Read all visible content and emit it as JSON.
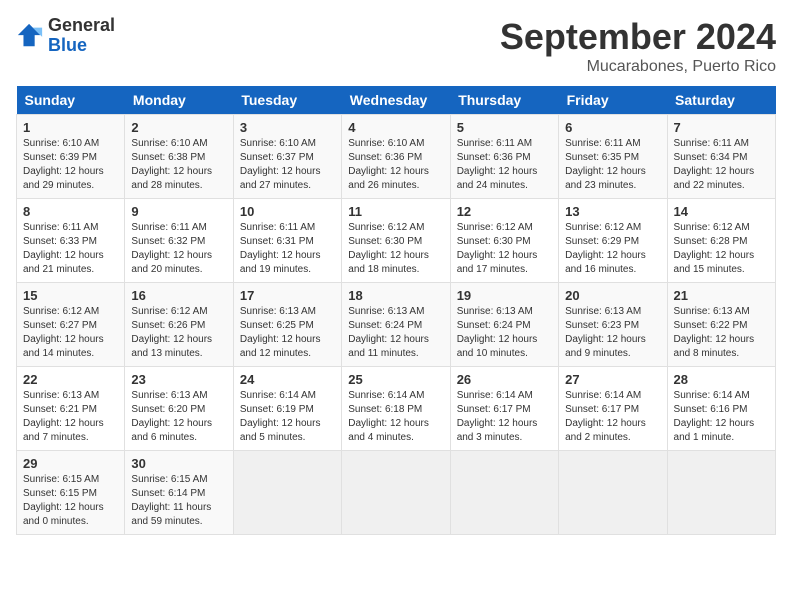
{
  "header": {
    "logo_general": "General",
    "logo_blue": "Blue",
    "month_title": "September 2024",
    "location": "Mucarabones, Puerto Rico"
  },
  "columns": [
    "Sunday",
    "Monday",
    "Tuesday",
    "Wednesday",
    "Thursday",
    "Friday",
    "Saturday"
  ],
  "weeks": [
    [
      {
        "day": "1",
        "sunrise": "Sunrise: 6:10 AM",
        "sunset": "Sunset: 6:39 PM",
        "daylight": "Daylight: 12 hours and 29 minutes."
      },
      {
        "day": "2",
        "sunrise": "Sunrise: 6:10 AM",
        "sunset": "Sunset: 6:38 PM",
        "daylight": "Daylight: 12 hours and 28 minutes."
      },
      {
        "day": "3",
        "sunrise": "Sunrise: 6:10 AM",
        "sunset": "Sunset: 6:37 PM",
        "daylight": "Daylight: 12 hours and 27 minutes."
      },
      {
        "day": "4",
        "sunrise": "Sunrise: 6:10 AM",
        "sunset": "Sunset: 6:36 PM",
        "daylight": "Daylight: 12 hours and 26 minutes."
      },
      {
        "day": "5",
        "sunrise": "Sunrise: 6:11 AM",
        "sunset": "Sunset: 6:36 PM",
        "daylight": "Daylight: 12 hours and 24 minutes."
      },
      {
        "day": "6",
        "sunrise": "Sunrise: 6:11 AM",
        "sunset": "Sunset: 6:35 PM",
        "daylight": "Daylight: 12 hours and 23 minutes."
      },
      {
        "day": "7",
        "sunrise": "Sunrise: 6:11 AM",
        "sunset": "Sunset: 6:34 PM",
        "daylight": "Daylight: 12 hours and 22 minutes."
      }
    ],
    [
      {
        "day": "8",
        "sunrise": "Sunrise: 6:11 AM",
        "sunset": "Sunset: 6:33 PM",
        "daylight": "Daylight: 12 hours and 21 minutes."
      },
      {
        "day": "9",
        "sunrise": "Sunrise: 6:11 AM",
        "sunset": "Sunset: 6:32 PM",
        "daylight": "Daylight: 12 hours and 20 minutes."
      },
      {
        "day": "10",
        "sunrise": "Sunrise: 6:11 AM",
        "sunset": "Sunset: 6:31 PM",
        "daylight": "Daylight: 12 hours and 19 minutes."
      },
      {
        "day": "11",
        "sunrise": "Sunrise: 6:12 AM",
        "sunset": "Sunset: 6:30 PM",
        "daylight": "Daylight: 12 hours and 18 minutes."
      },
      {
        "day": "12",
        "sunrise": "Sunrise: 6:12 AM",
        "sunset": "Sunset: 6:30 PM",
        "daylight": "Daylight: 12 hours and 17 minutes."
      },
      {
        "day": "13",
        "sunrise": "Sunrise: 6:12 AM",
        "sunset": "Sunset: 6:29 PM",
        "daylight": "Daylight: 12 hours and 16 minutes."
      },
      {
        "day": "14",
        "sunrise": "Sunrise: 6:12 AM",
        "sunset": "Sunset: 6:28 PM",
        "daylight": "Daylight: 12 hours and 15 minutes."
      }
    ],
    [
      {
        "day": "15",
        "sunrise": "Sunrise: 6:12 AM",
        "sunset": "Sunset: 6:27 PM",
        "daylight": "Daylight: 12 hours and 14 minutes."
      },
      {
        "day": "16",
        "sunrise": "Sunrise: 6:12 AM",
        "sunset": "Sunset: 6:26 PM",
        "daylight": "Daylight: 12 hours and 13 minutes."
      },
      {
        "day": "17",
        "sunrise": "Sunrise: 6:13 AM",
        "sunset": "Sunset: 6:25 PM",
        "daylight": "Daylight: 12 hours and 12 minutes."
      },
      {
        "day": "18",
        "sunrise": "Sunrise: 6:13 AM",
        "sunset": "Sunset: 6:24 PM",
        "daylight": "Daylight: 12 hours and 11 minutes."
      },
      {
        "day": "19",
        "sunrise": "Sunrise: 6:13 AM",
        "sunset": "Sunset: 6:24 PM",
        "daylight": "Daylight: 12 hours and 10 minutes."
      },
      {
        "day": "20",
        "sunrise": "Sunrise: 6:13 AM",
        "sunset": "Sunset: 6:23 PM",
        "daylight": "Daylight: 12 hours and 9 minutes."
      },
      {
        "day": "21",
        "sunrise": "Sunrise: 6:13 AM",
        "sunset": "Sunset: 6:22 PM",
        "daylight": "Daylight: 12 hours and 8 minutes."
      }
    ],
    [
      {
        "day": "22",
        "sunrise": "Sunrise: 6:13 AM",
        "sunset": "Sunset: 6:21 PM",
        "daylight": "Daylight: 12 hours and 7 minutes."
      },
      {
        "day": "23",
        "sunrise": "Sunrise: 6:13 AM",
        "sunset": "Sunset: 6:20 PM",
        "daylight": "Daylight: 12 hours and 6 minutes."
      },
      {
        "day": "24",
        "sunrise": "Sunrise: 6:14 AM",
        "sunset": "Sunset: 6:19 PM",
        "daylight": "Daylight: 12 hours and 5 minutes."
      },
      {
        "day": "25",
        "sunrise": "Sunrise: 6:14 AM",
        "sunset": "Sunset: 6:18 PM",
        "daylight": "Daylight: 12 hours and 4 minutes."
      },
      {
        "day": "26",
        "sunrise": "Sunrise: 6:14 AM",
        "sunset": "Sunset: 6:17 PM",
        "daylight": "Daylight: 12 hours and 3 minutes."
      },
      {
        "day": "27",
        "sunrise": "Sunrise: 6:14 AM",
        "sunset": "Sunset: 6:17 PM",
        "daylight": "Daylight: 12 hours and 2 minutes."
      },
      {
        "day": "28",
        "sunrise": "Sunrise: 6:14 AM",
        "sunset": "Sunset: 6:16 PM",
        "daylight": "Daylight: 12 hours and 1 minute."
      }
    ],
    [
      {
        "day": "29",
        "sunrise": "Sunrise: 6:15 AM",
        "sunset": "Sunset: 6:15 PM",
        "daylight": "Daylight: 12 hours and 0 minutes."
      },
      {
        "day": "30",
        "sunrise": "Sunrise: 6:15 AM",
        "sunset": "Sunset: 6:14 PM",
        "daylight": "Daylight: 11 hours and 59 minutes."
      },
      null,
      null,
      null,
      null,
      null
    ]
  ]
}
